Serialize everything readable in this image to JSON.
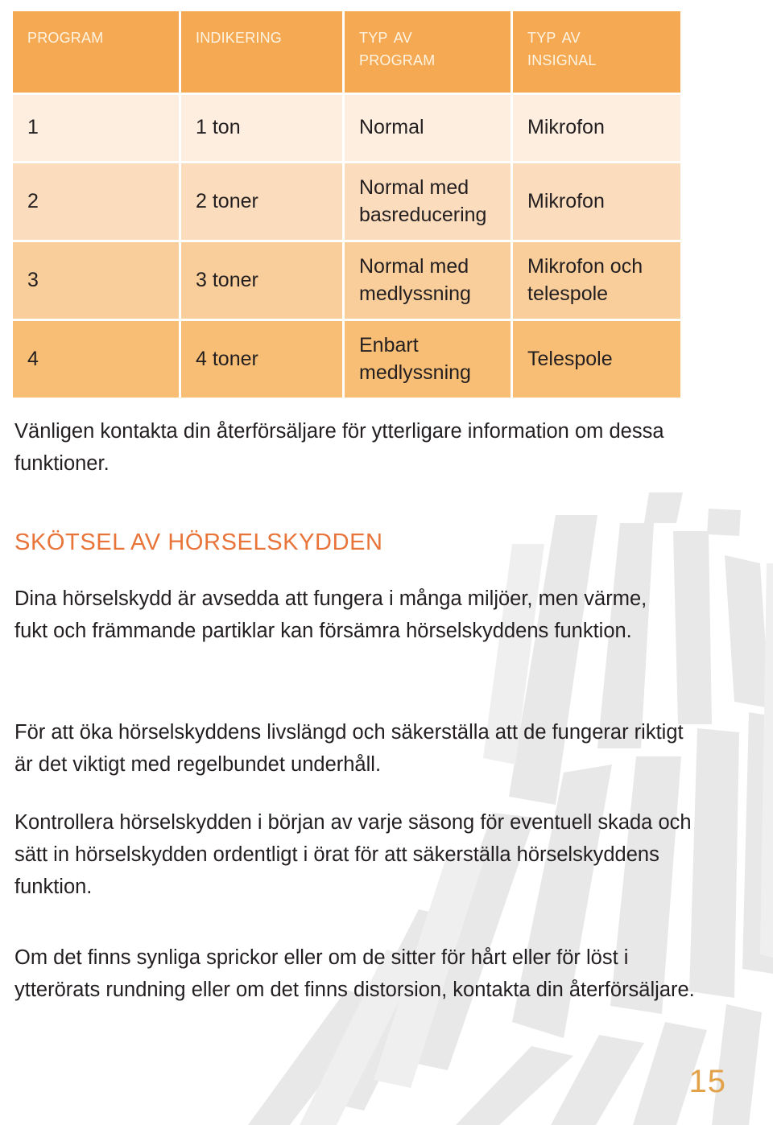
{
  "page": {
    "number": "15",
    "language": "sv",
    "accent_orange": "#e8743a",
    "header_orange": "#f5a953",
    "page_number_color": "#e2a24a",
    "background": "#ffffff"
  },
  "table": {
    "name": "program-table",
    "columns": [
      {
        "label": "Program"
      },
      {
        "label": "Indikering"
      },
      {
        "label_line1": "Typ av",
        "label_line2": "program"
      },
      {
        "label_line1": "Typ av",
        "label_line2": "insignal"
      }
    ],
    "rows": [
      {
        "program": "1",
        "indikering": "1 ton",
        "typ_av_program": "Normal",
        "typ_av_insignal": "Mikrofon",
        "bg": "#fdeee0"
      },
      {
        "program": "2",
        "indikering": "2 toner",
        "typ_av_program": "Normal med basreducering",
        "typ_av_insignal": "Mikrofon",
        "bg": "#fbdcbd"
      },
      {
        "program": "3",
        "indikering": "3 toner",
        "typ_av_program": "Normal med medlyssning",
        "typ_av_insignal": "Mikrofon och telespole",
        "bg": "#f9ce9a"
      },
      {
        "program": "4",
        "indikering": "4 toner",
        "typ_av_program": "Enbart medlyssning",
        "typ_av_insignal": "Telespole",
        "bg": "#f8be76"
      }
    ]
  },
  "intro": {
    "paragraph": "Vänligen kontakta din återförsäljare för ytterligare information om dessa funktioner."
  },
  "section": {
    "heading": "SKÖTSEL AV HÖRSELSKYDDEN",
    "paragraphs": [
      "Dina hörselskydd är avsedda att fungera i många miljöer, men värme, fukt och främmande partiklar kan försämra hörselskyddens funktion.",
      "För att öka hörselskyddens livslängd och säkerställa att de fungerar riktigt är det viktigt med regelbundet underhåll.",
      "Kontrollera hörselskydden i början av varje säsong för eventuell skada och sätt in hörselskydden ordentligt i örat för att säkerställa hörselskyddens funktion.",
      "Om det finns synliga sprickor eller om de sitter för hårt eller för löst i ytterörats rundning eller om det finns distorsion, kontakta din återförsäljare."
    ]
  }
}
